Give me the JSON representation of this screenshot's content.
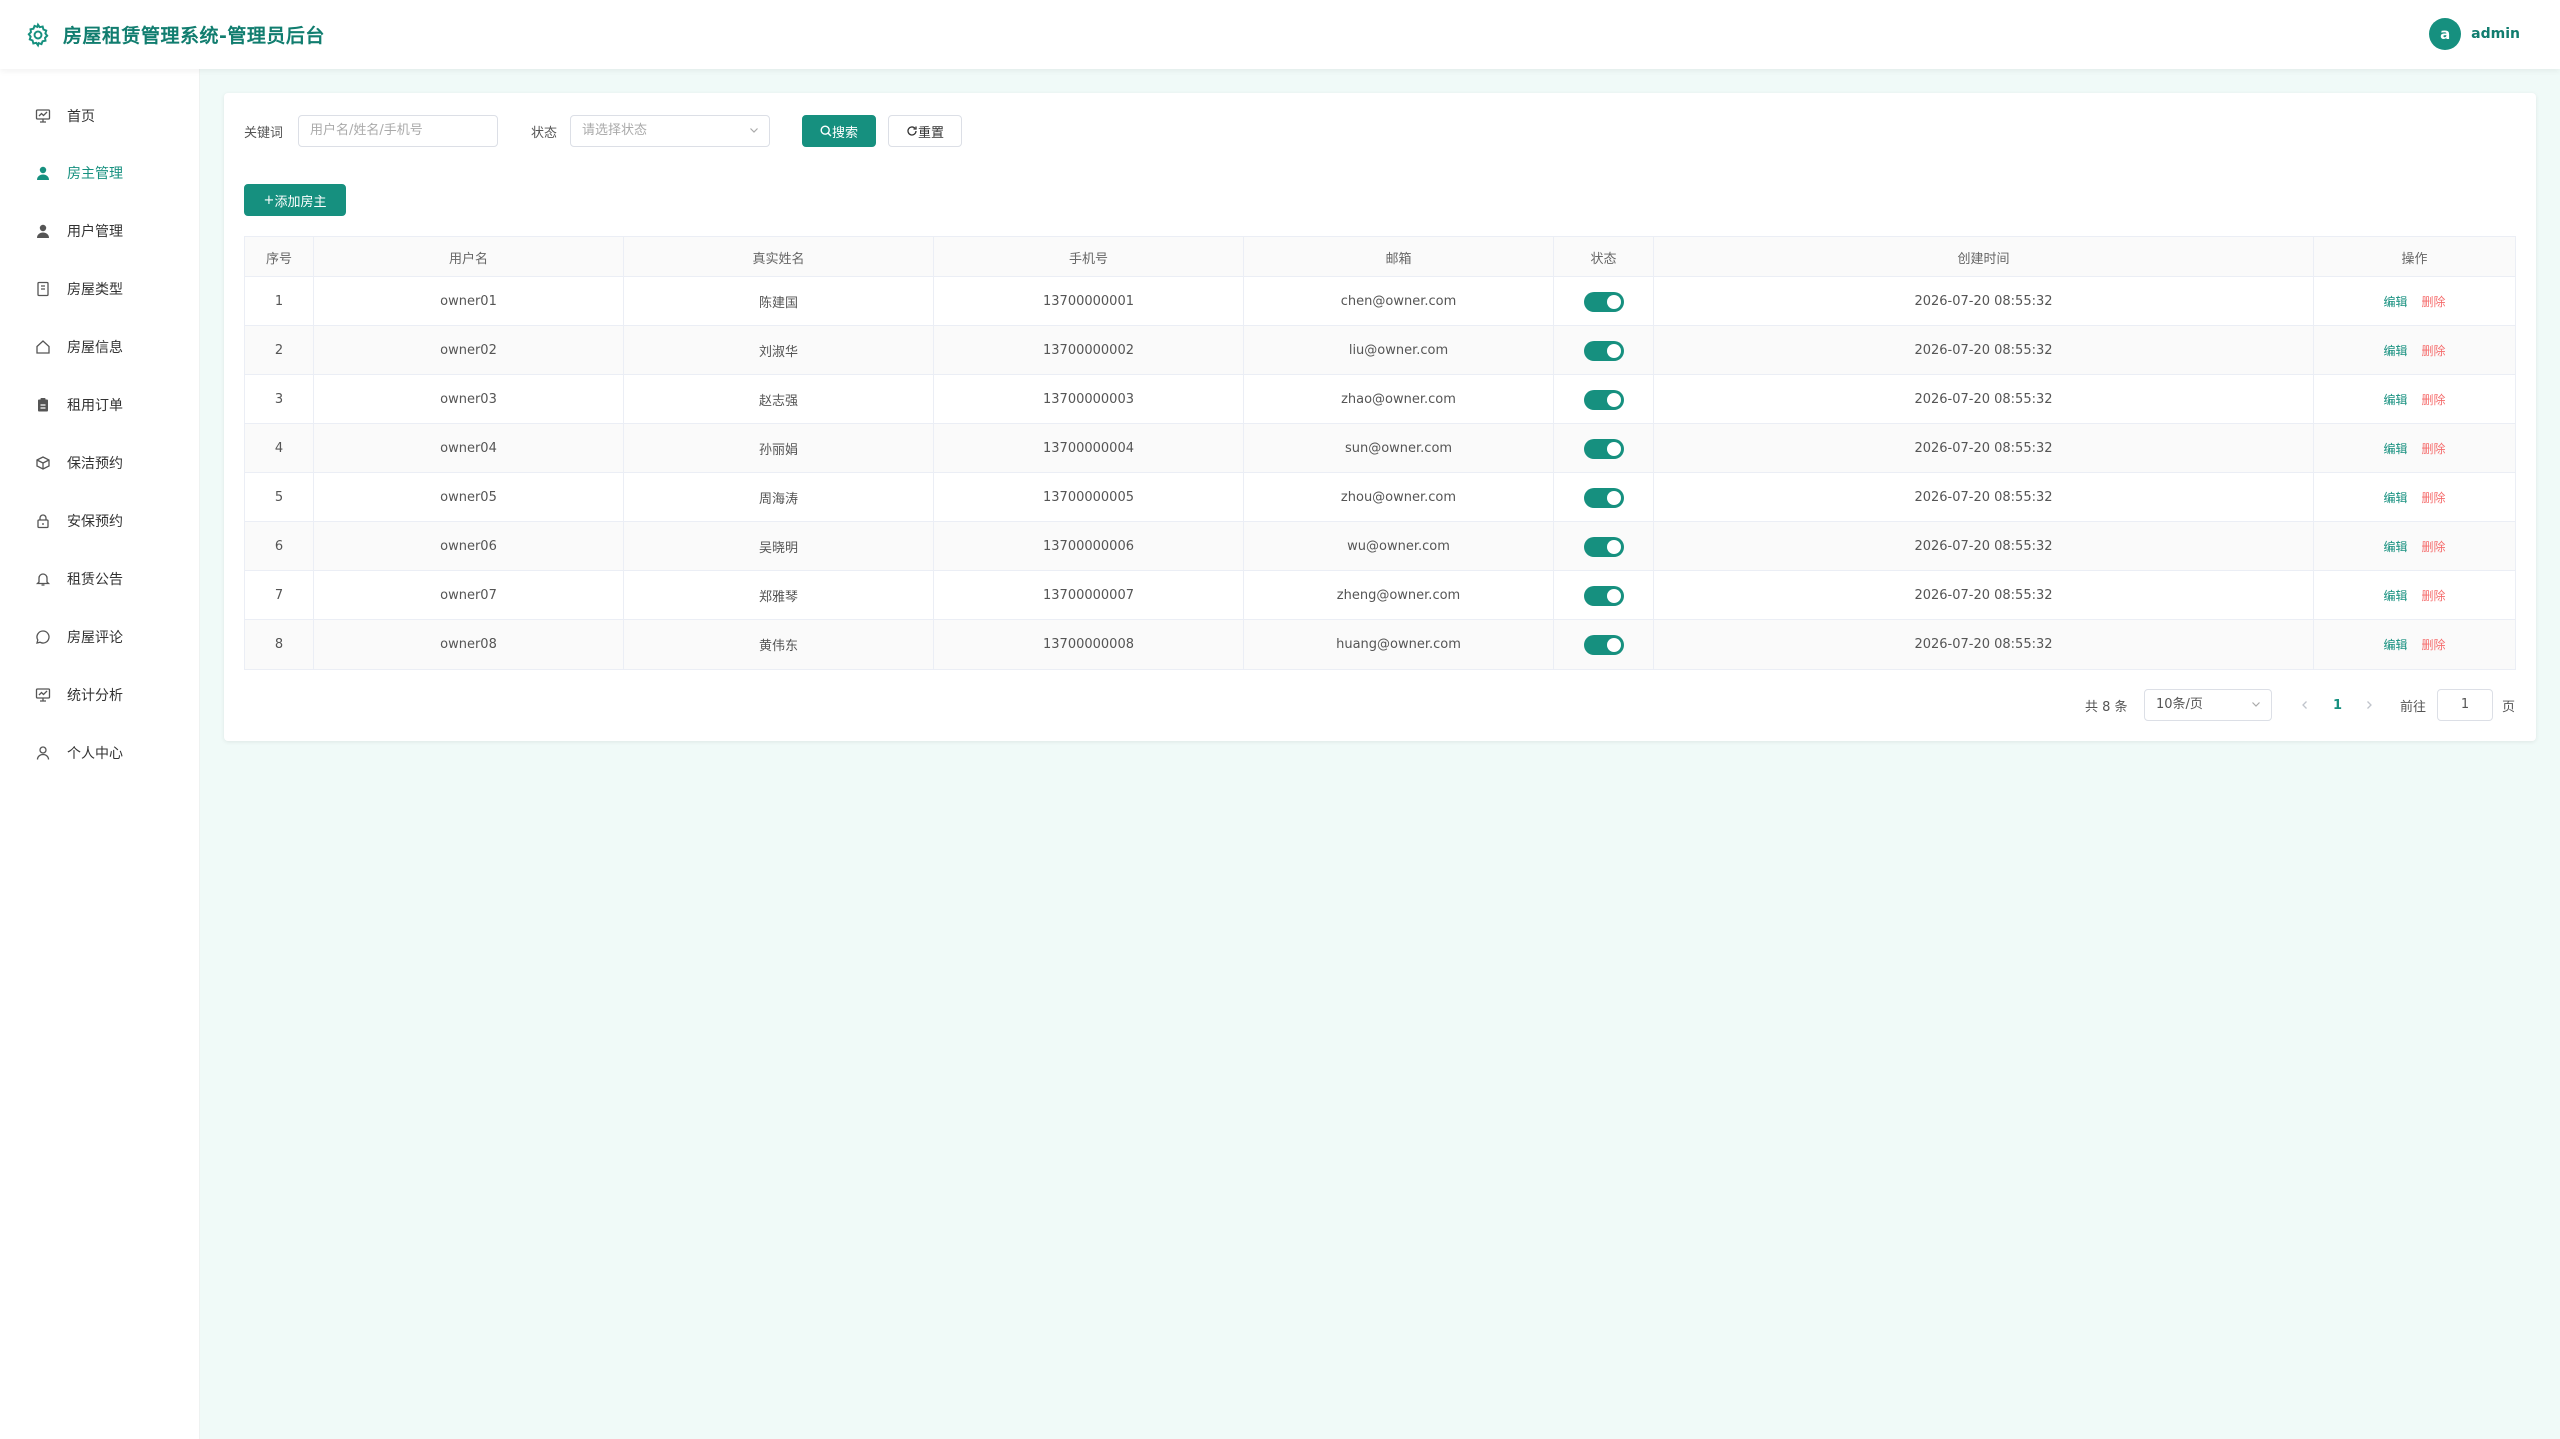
{
  "header": {
    "title": "房屋租赁管理系统-管理员后台",
    "avatar_letter": "a",
    "username": "admin"
  },
  "sidebar": {
    "items": [
      {
        "label": "首页",
        "icon": "dashboard-icon"
      },
      {
        "label": "房主管理",
        "icon": "user-filled-icon",
        "active": true
      },
      {
        "label": "用户管理",
        "icon": "user-filled-icon"
      },
      {
        "label": "房屋类型",
        "icon": "notebook-icon"
      },
      {
        "label": "房屋信息",
        "icon": "house-icon"
      },
      {
        "label": "租用订单",
        "icon": "clipboard-icon"
      },
      {
        "label": "保洁预约",
        "icon": "box-icon"
      },
      {
        "label": "安保预约",
        "icon": "lock-icon"
      },
      {
        "label": "租赁公告",
        "icon": "bell-icon"
      },
      {
        "label": "房屋评论",
        "icon": "chat-icon"
      },
      {
        "label": "统计分析",
        "icon": "chart-icon"
      },
      {
        "label": "个人中心",
        "icon": "user-icon"
      }
    ]
  },
  "search": {
    "keyword_label": "关键词",
    "keyword_placeholder": "用户名/姓名/手机号",
    "status_label": "状态",
    "status_placeholder": "请选择状态",
    "search_button": "搜索",
    "reset_button": "重置"
  },
  "add_button": "添加房主",
  "table": {
    "columns": [
      "序号",
      "用户名",
      "真实姓名",
      "手机号",
      "邮箱",
      "状态",
      "创建时间",
      "操作"
    ],
    "rows": [
      {
        "index": "1",
        "username": "owner01",
        "realname": "陈建国",
        "phone": "13700000001",
        "email": "chen@owner.com",
        "enabled": true,
        "created": "2026-07-20 08:55:32"
      },
      {
        "index": "2",
        "username": "owner02",
        "realname": "刘淑华",
        "phone": "13700000002",
        "email": "liu@owner.com",
        "enabled": true,
        "created": "2026-07-20 08:55:32"
      },
      {
        "index": "3",
        "username": "owner03",
        "realname": "赵志强",
        "phone": "13700000003",
        "email": "zhao@owner.com",
        "enabled": true,
        "created": "2026-07-20 08:55:32"
      },
      {
        "index": "4",
        "username": "owner04",
        "realname": "孙丽娟",
        "phone": "13700000004",
        "email": "sun@owner.com",
        "enabled": true,
        "created": "2026-07-20 08:55:32"
      },
      {
        "index": "5",
        "username": "owner05",
        "realname": "周海涛",
        "phone": "13700000005",
        "email": "zhou@owner.com",
        "enabled": true,
        "created": "2026-07-20 08:55:32"
      },
      {
        "index": "6",
        "username": "owner06",
        "realname": "吴晓明",
        "phone": "13700000006",
        "email": "wu@owner.com",
        "enabled": true,
        "created": "2026-07-20 08:55:32"
      },
      {
        "index": "7",
        "username": "owner07",
        "realname": "郑雅琴",
        "phone": "13700000007",
        "email": "zheng@owner.com",
        "enabled": true,
        "created": "2026-07-20 08:55:32"
      },
      {
        "index": "8",
        "username": "owner08",
        "realname": "黄伟东",
        "phone": "13700000008",
        "email": "huang@owner.com",
        "enabled": true,
        "created": "2026-07-20 08:55:32"
      }
    ],
    "edit_label": "编辑",
    "delete_label": "删除"
  },
  "pagination": {
    "total_text": "共 8 条",
    "page_size": "10条/页",
    "current_page": "1",
    "goto_label": "前往",
    "goto_value": "1",
    "page_suffix": "页"
  },
  "colors": {
    "primary": "#16907f",
    "danger": "#f56c6c",
    "background": "#f0faf8"
  }
}
